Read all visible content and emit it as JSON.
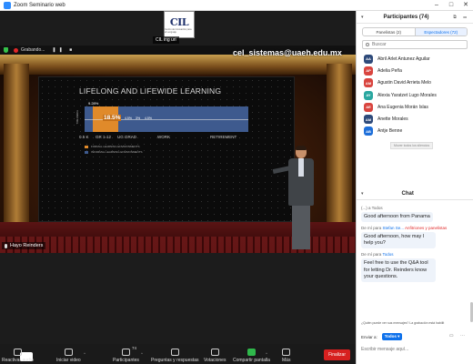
{
  "window": {
    "title": "Zoom Seminario web",
    "minimize": "–",
    "maximize": "□",
    "close": "✕"
  },
  "thumbnail": {
    "logo": "CIL",
    "subtitle": "Centro de Innovación para el Lenguaje",
    "name_tag": "CIL ing uri"
  },
  "recording": {
    "label": "Grabando...",
    "controls": "❚❚ ■"
  },
  "share": {
    "email": "cel_sistemas@uaeh.edu.mx"
  },
  "slide": {
    "title": "LIFELONG AND LIFEWIDE LEARNING",
    "top_pct": "9.28%",
    "main_pct": "18.5%",
    "tiny_pcts": [
      "4.5%",
      "3%",
      "4.5%"
    ],
    "side_label": "TIME AWAKE",
    "axis": [
      "0.5 K",
      "GR 1-12",
      "UG GRAD",
      "WORK",
      "RETIREMENT"
    ],
    "legend": [
      {
        "label": "FORMAL LEARNING ENVIRONMENTS",
        "color": "#e08a2a"
      },
      {
        "label": "INFORMAL LEARNING ENVIRONMENTS",
        "color": "#3e5a8e"
      }
    ]
  },
  "speaker": {
    "name": "Hayo Reinders"
  },
  "toolbar": {
    "items": [
      {
        "label": "Reactivar audio",
        "name": "unmute-button"
      },
      {
        "label": "Iniciar video",
        "name": "start-video-button"
      },
      {
        "label": "Participantes",
        "name": "participants-button",
        "count": "74"
      },
      {
        "label": "Preguntas y respuestas",
        "name": "qa-button"
      },
      {
        "label": "Votaciones",
        "name": "polls-button"
      },
      {
        "label": "Compartir pantalla",
        "name": "share-screen-button"
      },
      {
        "label": "Más",
        "name": "more-button"
      }
    ],
    "end": "Finalizar"
  },
  "participants": {
    "title": "Participantes (74)",
    "tabs": [
      "Panelistas (2)",
      "Espectadores (72)"
    ],
    "search_placeholder": "Buscar",
    "list": [
      {
        "initials": "AA",
        "name": "Abril Arlet Antunez Aguilar",
        "color": "#2e4a7a"
      },
      {
        "initials": "AP",
        "name": "Adelia Peña",
        "color": "#d9453f"
      },
      {
        "initials": "AM",
        "name": "Agustin David Arrieta Melo",
        "color": "#d9453f"
      },
      {
        "initials": "AY",
        "name": "Alexia Yaratzet Lugo Morales",
        "color": "#2aa7a0"
      },
      {
        "initials": "AE",
        "name": "Ana Eugenia Morán Islas",
        "color": "#d9453f"
      },
      {
        "initials": "AM",
        "name": "Anette Morales",
        "color": "#2e4a7a"
      },
      {
        "initials": "AB",
        "name": "Antje Benne",
        "color": "#1e6fd9"
      }
    ],
    "tooltip": "Mover todos los silencios"
  },
  "chat": {
    "title": "Chat",
    "messages": [
      {
        "meta": "(...) a Todos",
        "text": "Good afternoon from Panama"
      },
      {
        "meta_prefix": "De mí para ",
        "meta_to": "Stefan Se...",
        "meta_suffix": " Anfitriones y panelistas",
        "text": "Good afternoon, how may I help you?"
      },
      {
        "meta_prefix": "De mí para ",
        "meta_to": "Todos",
        "meta_suffix": "",
        "text": "Feel free to use the Q&A tool for letting Dr. Reinders know your questions."
      }
    ],
    "note": "¿Quién puede ver sus mensajes? La grabación está habilit",
    "send_to_label": "Enviar a:",
    "send_to_value": "Todos ▾",
    "input_placeholder": "Escribir mensaje aquí..."
  }
}
